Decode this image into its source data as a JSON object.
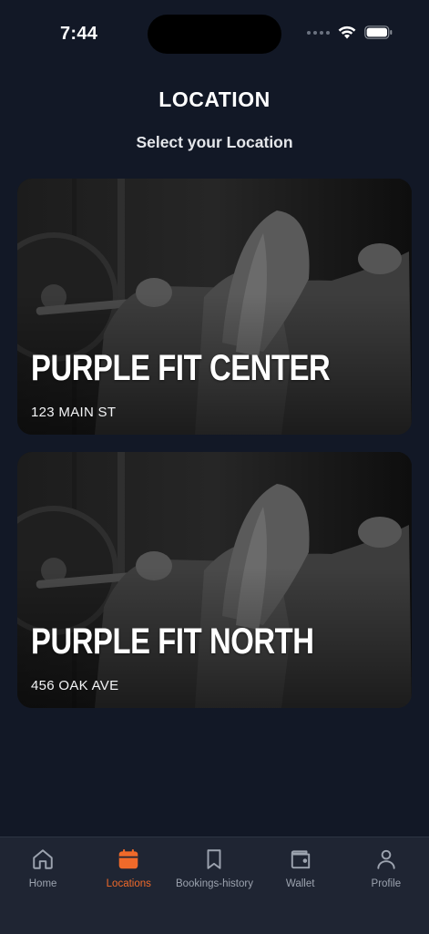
{
  "status_bar": {
    "time": "7:44"
  },
  "header": {
    "title": "LOCATION",
    "subtitle": "Select your Location"
  },
  "locations": [
    {
      "name": "PURPLE FIT CENTER",
      "address": "123 MAIN ST"
    },
    {
      "name": "PURPLE FIT NORTH",
      "address": "456 OAK AVE"
    }
  ],
  "bottom_nav": {
    "active_color": "#f06a2a",
    "inactive_color": "#9ca3af",
    "items": [
      {
        "label": "Home",
        "icon": "home-icon",
        "active": false
      },
      {
        "label": "Locations",
        "icon": "calendar-icon",
        "active": true
      },
      {
        "label": "Bookings-history",
        "icon": "bookmark-icon",
        "active": false
      },
      {
        "label": "Wallet",
        "icon": "wallet-icon",
        "active": false
      },
      {
        "label": "Profile",
        "icon": "user-icon",
        "active": false
      }
    ]
  }
}
